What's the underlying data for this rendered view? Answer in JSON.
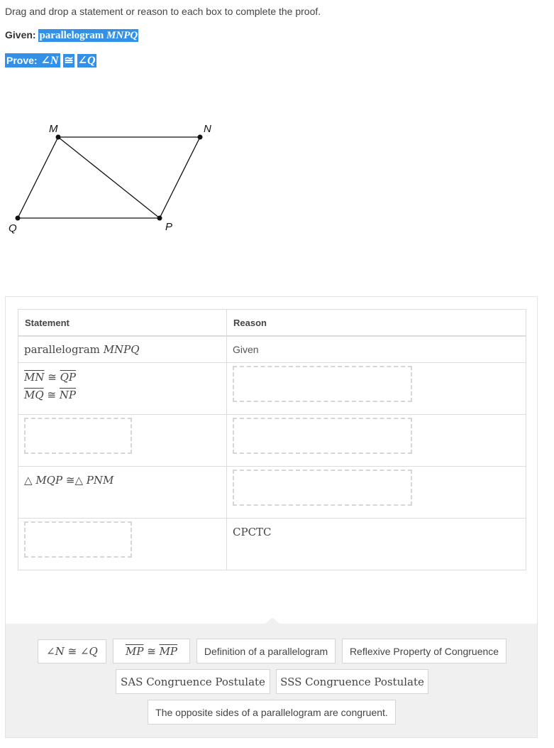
{
  "instructions": "Drag and drop a statement or reason to each box to complete the proof.",
  "given": {
    "label": "Given:",
    "value_word": "parallelogram",
    "value_math": "MNPQ"
  },
  "prove": {
    "label": "Prove:",
    "left": "∠N",
    "symbol": "≅",
    "right": "∠Q"
  },
  "diagram": {
    "vertices": [
      "M",
      "N",
      "P",
      "Q"
    ],
    "segments": [
      "MN",
      "NP",
      "PQ",
      "QM",
      "MP"
    ]
  },
  "table": {
    "headers": [
      "Statement",
      "Reason"
    ],
    "rows": [
      {
        "statement_word": "parallelogram",
        "statement_math": "MNPQ",
        "reason": "Given"
      },
      {
        "statement_line1": {
          "a": "MN",
          "sym": "≅",
          "b": "QP"
        },
        "statement_line2": {
          "a": "MQ",
          "sym": "≅",
          "b": "NP"
        },
        "reason": null
      },
      {
        "statement": null,
        "reason": null
      },
      {
        "statement_tri": {
          "tri": "△",
          "a": "MQP",
          "sym": "≅",
          "b": "PNM"
        },
        "reason": null
      },
      {
        "statement": null,
        "reason": "CPCTC"
      }
    ]
  },
  "answer_bank": [
    {
      "id": "angle-n-q",
      "parts": {
        "a": "∠N",
        "sym": "≅",
        "b": "∠Q"
      }
    },
    {
      "id": "mp-mp",
      "parts": {
        "a": "MP",
        "sym": "≅",
        "b": "MP"
      }
    },
    {
      "id": "def-parallelogram",
      "label": "Definition of a parallelogram"
    },
    {
      "id": "reflexive",
      "label": "Reflexive Property of Congruence"
    },
    {
      "id": "sas",
      "label": "SAS Congruence Postulate"
    },
    {
      "id": "sss",
      "label": "SSS Congruence Postulate"
    },
    {
      "id": "opposite-sides",
      "label": "The opposite sides of a parallelogram are congruent."
    }
  ],
  "colors": {
    "selection": "#3390e8",
    "bank_bg": "#f0f0f0",
    "border": "#dcdcdc"
  }
}
